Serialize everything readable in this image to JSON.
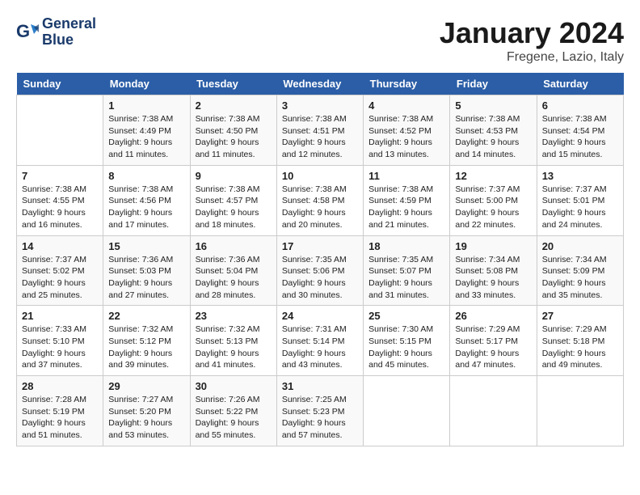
{
  "logo": {
    "line1": "General",
    "line2": "Blue"
  },
  "title": "January 2024",
  "subtitle": "Fregene, Lazio, Italy",
  "days_header": [
    "Sunday",
    "Monday",
    "Tuesday",
    "Wednesday",
    "Thursday",
    "Friday",
    "Saturday"
  ],
  "weeks": [
    [
      {
        "day": "",
        "info": ""
      },
      {
        "day": "1",
        "info": "Sunrise: 7:38 AM\nSunset: 4:49 PM\nDaylight: 9 hours\nand 11 minutes."
      },
      {
        "day": "2",
        "info": "Sunrise: 7:38 AM\nSunset: 4:50 PM\nDaylight: 9 hours\nand 11 minutes."
      },
      {
        "day": "3",
        "info": "Sunrise: 7:38 AM\nSunset: 4:51 PM\nDaylight: 9 hours\nand 12 minutes."
      },
      {
        "day": "4",
        "info": "Sunrise: 7:38 AM\nSunset: 4:52 PM\nDaylight: 9 hours\nand 13 minutes."
      },
      {
        "day": "5",
        "info": "Sunrise: 7:38 AM\nSunset: 4:53 PM\nDaylight: 9 hours\nand 14 minutes."
      },
      {
        "day": "6",
        "info": "Sunrise: 7:38 AM\nSunset: 4:54 PM\nDaylight: 9 hours\nand 15 minutes."
      }
    ],
    [
      {
        "day": "7",
        "info": "Sunrise: 7:38 AM\nSunset: 4:55 PM\nDaylight: 9 hours\nand 16 minutes."
      },
      {
        "day": "8",
        "info": "Sunrise: 7:38 AM\nSunset: 4:56 PM\nDaylight: 9 hours\nand 17 minutes."
      },
      {
        "day": "9",
        "info": "Sunrise: 7:38 AM\nSunset: 4:57 PM\nDaylight: 9 hours\nand 18 minutes."
      },
      {
        "day": "10",
        "info": "Sunrise: 7:38 AM\nSunset: 4:58 PM\nDaylight: 9 hours\nand 20 minutes."
      },
      {
        "day": "11",
        "info": "Sunrise: 7:38 AM\nSunset: 4:59 PM\nDaylight: 9 hours\nand 21 minutes."
      },
      {
        "day": "12",
        "info": "Sunrise: 7:37 AM\nSunset: 5:00 PM\nDaylight: 9 hours\nand 22 minutes."
      },
      {
        "day": "13",
        "info": "Sunrise: 7:37 AM\nSunset: 5:01 PM\nDaylight: 9 hours\nand 24 minutes."
      }
    ],
    [
      {
        "day": "14",
        "info": "Sunrise: 7:37 AM\nSunset: 5:02 PM\nDaylight: 9 hours\nand 25 minutes."
      },
      {
        "day": "15",
        "info": "Sunrise: 7:36 AM\nSunset: 5:03 PM\nDaylight: 9 hours\nand 27 minutes."
      },
      {
        "day": "16",
        "info": "Sunrise: 7:36 AM\nSunset: 5:04 PM\nDaylight: 9 hours\nand 28 minutes."
      },
      {
        "day": "17",
        "info": "Sunrise: 7:35 AM\nSunset: 5:06 PM\nDaylight: 9 hours\nand 30 minutes."
      },
      {
        "day": "18",
        "info": "Sunrise: 7:35 AM\nSunset: 5:07 PM\nDaylight: 9 hours\nand 31 minutes."
      },
      {
        "day": "19",
        "info": "Sunrise: 7:34 AM\nSunset: 5:08 PM\nDaylight: 9 hours\nand 33 minutes."
      },
      {
        "day": "20",
        "info": "Sunrise: 7:34 AM\nSunset: 5:09 PM\nDaylight: 9 hours\nand 35 minutes."
      }
    ],
    [
      {
        "day": "21",
        "info": "Sunrise: 7:33 AM\nSunset: 5:10 PM\nDaylight: 9 hours\nand 37 minutes."
      },
      {
        "day": "22",
        "info": "Sunrise: 7:32 AM\nSunset: 5:12 PM\nDaylight: 9 hours\nand 39 minutes."
      },
      {
        "day": "23",
        "info": "Sunrise: 7:32 AM\nSunset: 5:13 PM\nDaylight: 9 hours\nand 41 minutes."
      },
      {
        "day": "24",
        "info": "Sunrise: 7:31 AM\nSunset: 5:14 PM\nDaylight: 9 hours\nand 43 minutes."
      },
      {
        "day": "25",
        "info": "Sunrise: 7:30 AM\nSunset: 5:15 PM\nDaylight: 9 hours\nand 45 minutes."
      },
      {
        "day": "26",
        "info": "Sunrise: 7:29 AM\nSunset: 5:17 PM\nDaylight: 9 hours\nand 47 minutes."
      },
      {
        "day": "27",
        "info": "Sunrise: 7:29 AM\nSunset: 5:18 PM\nDaylight: 9 hours\nand 49 minutes."
      }
    ],
    [
      {
        "day": "28",
        "info": "Sunrise: 7:28 AM\nSunset: 5:19 PM\nDaylight: 9 hours\nand 51 minutes."
      },
      {
        "day": "29",
        "info": "Sunrise: 7:27 AM\nSunset: 5:20 PM\nDaylight: 9 hours\nand 53 minutes."
      },
      {
        "day": "30",
        "info": "Sunrise: 7:26 AM\nSunset: 5:22 PM\nDaylight: 9 hours\nand 55 minutes."
      },
      {
        "day": "31",
        "info": "Sunrise: 7:25 AM\nSunset: 5:23 PM\nDaylight: 9 hours\nand 57 minutes."
      },
      {
        "day": "",
        "info": ""
      },
      {
        "day": "",
        "info": ""
      },
      {
        "day": "",
        "info": ""
      }
    ]
  ]
}
